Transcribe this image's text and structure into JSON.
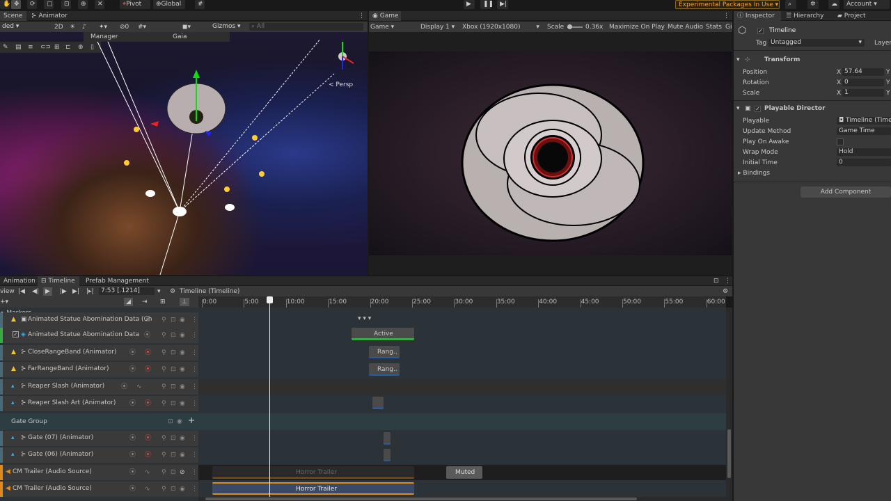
{
  "toolbar": {
    "pivot": "Pivot",
    "global": "Global",
    "experimental": "Experimental Packages In Use",
    "account": "Account"
  },
  "scene": {
    "tab": "Scene",
    "animator_tab": "Animator",
    "shading": "ded",
    "mode2d": "2D",
    "gizmos": "Gizmos",
    "search_placeholder": "All",
    "counter": "0",
    "overlay_manager": "Manager",
    "overlay_gaia": "Gaia",
    "persp": "< Persp"
  },
  "game": {
    "tab": "Game",
    "view": "Game",
    "display": "Display 1",
    "resolution": "Xbox (1920x1080)",
    "scale_label": "Scale",
    "scale_value": "0.36x",
    "maximize": "Maximize On Play",
    "mute": "Mute Audio",
    "stats": "Stats",
    "gizmos": "Gi"
  },
  "inspector": {
    "tabs": [
      "Inspector",
      "Hierarchy",
      "Project"
    ],
    "object_name": "Timeline",
    "tag_label": "Tag",
    "tag_value": "Untagged",
    "layer_label": "Layer",
    "transform": {
      "title": "Transform",
      "position_label": "Position",
      "position_x": "57.64",
      "rotation_label": "Rotation",
      "rotation_x": "0",
      "scale_label": "Scale",
      "scale_x": "1",
      "axis_x": "X",
      "axis_y": "Y"
    },
    "director": {
      "title": "Playable Director",
      "playable_label": "Playable",
      "playable_value": "Timeline (Timel",
      "update_label": "Update Method",
      "update_value": "Game Time",
      "awake_label": "Play On Awake",
      "wrap_label": "Wrap Mode",
      "wrap_value": "Hold",
      "initial_label": "Initial Time",
      "initial_value": "0",
      "bindings_label": "Bindings"
    },
    "add_component": "Add Component"
  },
  "timeline": {
    "tabs": [
      "Animation",
      "Timeline",
      "Prefab Management"
    ],
    "view_label": "view",
    "time": "7:53 [.1214]",
    "asset": "Timeline (Timeline)",
    "ruler": [
      "0:00",
      "5:00",
      "10:00",
      "15:00",
      "20:00",
      "25:00",
      "30:00",
      "35:00",
      "40:00",
      "45:00",
      "50:00",
      "55:00",
      "60:00"
    ],
    "markers": "Markers",
    "tracks": [
      "Animated Statue Abomination Data (Ch",
      "Animated Statue Abomination Data",
      "CloseRangeBand (Animator)",
      "FarRangeBand (Animator)",
      "Reaper Slash (Animator)",
      "Reaper Slash Art (Animator)",
      "Gate Group",
      "Gate (07) (Animator)",
      "Gate (06) (Animator)",
      "CM Trailer (Audio Source)",
      "CM Trailer (Audio Source)"
    ],
    "clips": {
      "active": "Active",
      "rang1": "Rang..",
      "rang2": "Rang..",
      "horror1": "Horror Trailer",
      "horror2": "Horror Trailer",
      "muted": "Muted"
    }
  },
  "colors": {
    "accent": "#4a9eff",
    "warn": "#f2c230",
    "green": "#3aa845",
    "orange": "#e08a1c"
  }
}
